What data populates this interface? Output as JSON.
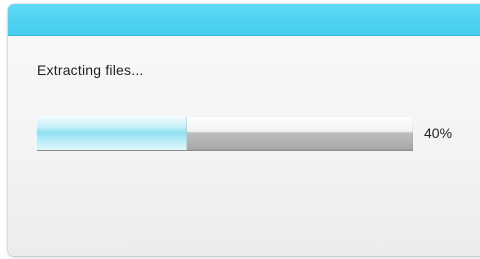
{
  "dialog": {
    "status_text": "Extracting files...",
    "progress_fraction": 0.4,
    "progress_label": "40%"
  },
  "colors": {
    "titlebar": "#4fd3f1",
    "fill": "#8fdff1"
  }
}
